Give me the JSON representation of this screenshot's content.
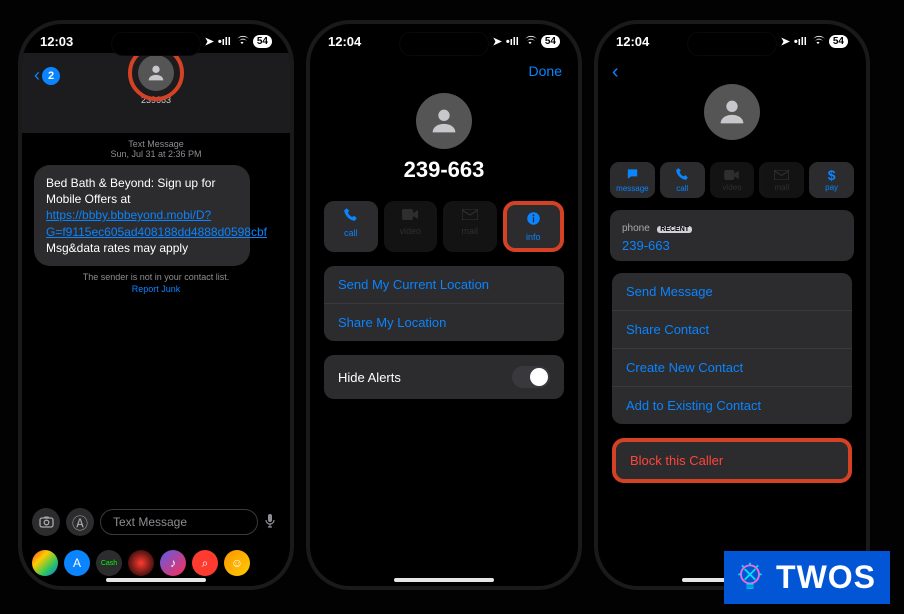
{
  "phone1": {
    "time": "12:03",
    "battery": "54",
    "back_badge": "2",
    "contact_number": "239663",
    "meta_line1": "Text Message",
    "meta_line2": "Sun, Jul 31 at 2:36 PM",
    "bubble_text_pre": "Bed Bath & Beyond: Sign up for Mobile Offers at ",
    "bubble_link": "https://bbby.bbbeyond.mobi/D?G=f9115ec605ad408188dd4888d0598cbf",
    "bubble_text_post": " Msg&data rates may apply",
    "junk_line": "The sender is not in your contact list.",
    "report_junk": "Report Junk",
    "input_placeholder": "Text Message"
  },
  "phone2": {
    "time": "12:04",
    "battery": "54",
    "done": "Done",
    "number": "239-663",
    "actions": [
      {
        "label": "call",
        "icon": "phone"
      },
      {
        "label": "video",
        "icon": "video"
      },
      {
        "label": "mail",
        "icon": "mail"
      },
      {
        "label": "info",
        "icon": "info"
      }
    ],
    "loc1": "Send My Current Location",
    "loc2": "Share My Location",
    "hide_alerts": "Hide Alerts"
  },
  "phone3": {
    "time": "12:04",
    "battery": "54",
    "actions": [
      {
        "label": "message"
      },
      {
        "label": "call"
      },
      {
        "label": "video"
      },
      {
        "label": "mail"
      },
      {
        "label": "pay"
      }
    ],
    "phone_label": "phone",
    "recent": "RECENT",
    "number": "239-663",
    "options": [
      "Send Message",
      "Share Contact",
      "Create New Contact",
      "Add to Existing Contact"
    ],
    "block": "Block this Caller"
  },
  "brand": "TWOS"
}
